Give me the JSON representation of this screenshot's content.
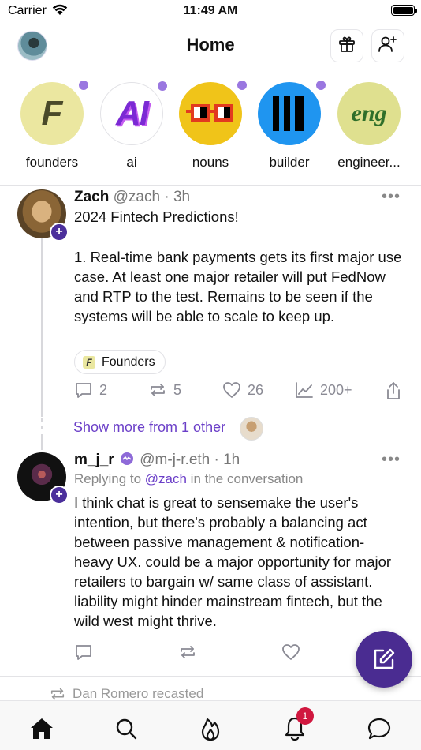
{
  "status_bar": {
    "carrier": "Carrier",
    "time": "11:49 AM"
  },
  "header": {
    "title": "Home"
  },
  "channels": [
    {
      "label": "founders",
      "glyph": "F",
      "bg": "#ebe7a0",
      "fg": "#4a4a2a",
      "unread": true
    },
    {
      "label": "ai",
      "glyph": "AI",
      "bg": "#ffffff",
      "fg": "#7b2ad4",
      "unread": true
    },
    {
      "label": "nouns",
      "glyph": "",
      "bg": "#f0c419",
      "fg": "#e23a1f",
      "unread": true
    },
    {
      "label": "builder",
      "glyph": "",
      "bg": "#1f95f0",
      "fg": "#000000",
      "unread": true
    },
    {
      "label": "engineer...",
      "glyph": "eng",
      "bg": "#dfe08f",
      "fg": "#2f6f2a",
      "unread": false
    }
  ],
  "post1": {
    "author": "Zach",
    "meta": "@zach · 3h",
    "title": "2024 Fintech Predictions!",
    "body": "1. Real-time bank payments gets its first major use case. At least one major retailer will put FedNow and RTP to the test. Remains to be seen if the systems will be able to scale to keep up.",
    "channel_chip": "Founders",
    "chip_glyph": "F",
    "replies": "2",
    "recasts": "5",
    "likes": "26",
    "views": "200+"
  },
  "show_more": "Show more from 1 other",
  "post2": {
    "author": "m_j_r",
    "meta": "@m-j-r.eth · 1h",
    "replying_prefix": "Replying to ",
    "replying_handle": "@zach",
    "replying_suffix": " in the conversation",
    "body": "I think chat is great to sensemake the user's intention, but there's probably a balancing act between passive management & notification-heavy UX. could be a major opportunity for major retailers to bargain w/ same class of assistant. liability might hinder mainstream fintech, but the wild west might thrive."
  },
  "recast_notice": "Dan Romero recasted",
  "tab_bar": {
    "notification_count": "1"
  },
  "colors": {
    "accent": "#6b3fc8",
    "fab": "#4a2c91",
    "badge": "#d0173f"
  }
}
